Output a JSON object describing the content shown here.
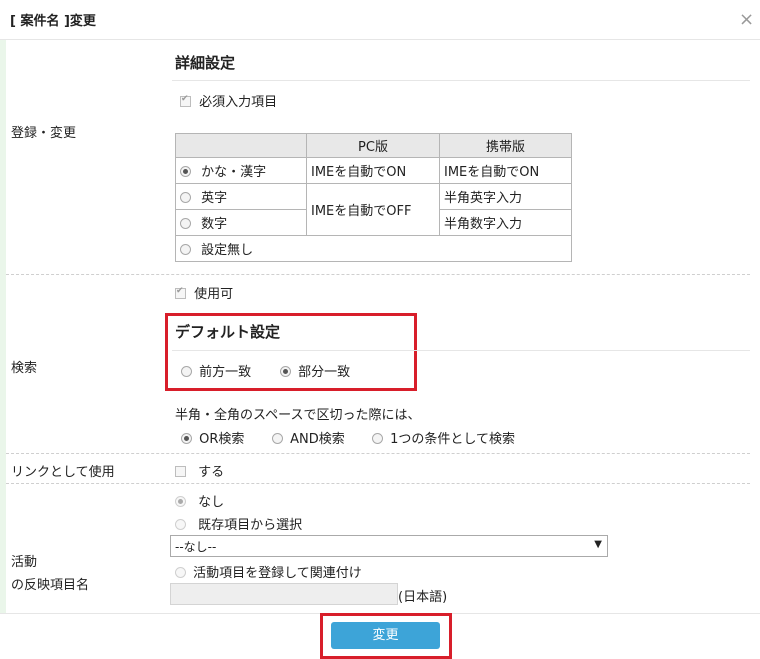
{
  "dialog": {
    "title": "[ 案件名 ]変更",
    "close_glyph": "×",
    "submit_label": "変更"
  },
  "rows": {
    "register_label": "登録・変更",
    "search_label": "検索",
    "link_label": "リンクとして使用",
    "activity_label_line1": "活動",
    "activity_label_line2": "の反映項目名"
  },
  "detail": {
    "heading": "詳細設定",
    "required_label": "必須入力項目",
    "required_checked": true,
    "table": {
      "headers": [
        "",
        "PC版",
        "携帯版"
      ],
      "options": [
        {
          "label": "かな・漢字",
          "selected": true
        },
        {
          "label": "英字",
          "selected": false
        },
        {
          "label": "数字",
          "selected": false
        },
        {
          "label": "設定無し",
          "selected": false
        }
      ],
      "pc_kana": "IMEを自動でON",
      "pc_alnum": "IMEを自動でOFF",
      "mobile_kana": "IMEを自動でON",
      "mobile_alpha": "半角英字入力",
      "mobile_num": "半角数字入力"
    }
  },
  "search": {
    "usable_label": "使用可",
    "usable_checked": true,
    "default_heading": "デフォルト設定",
    "match_options": [
      {
        "label": "前方一致",
        "selected": false
      },
      {
        "label": "部分一致",
        "selected": true
      }
    ],
    "space_note": "半角・全角のスペースで区切った際には、",
    "space_options": [
      {
        "label": "OR検索",
        "selected": true
      },
      {
        "label": "AND検索",
        "selected": false
      },
      {
        "label": "1つの条件として検索",
        "selected": false
      }
    ]
  },
  "link": {
    "checkbox_label": "する",
    "checked": false
  },
  "activity": {
    "option_none": "なし",
    "option_existing": "既存項目から選択",
    "select_value": "--なし--",
    "option_register": "活動項目を登録して関連付け",
    "text_value": "",
    "lang_suffix": "(日本語)"
  },
  "colors": {
    "highlight": "#d81e2a",
    "button": "#3da4d8"
  }
}
